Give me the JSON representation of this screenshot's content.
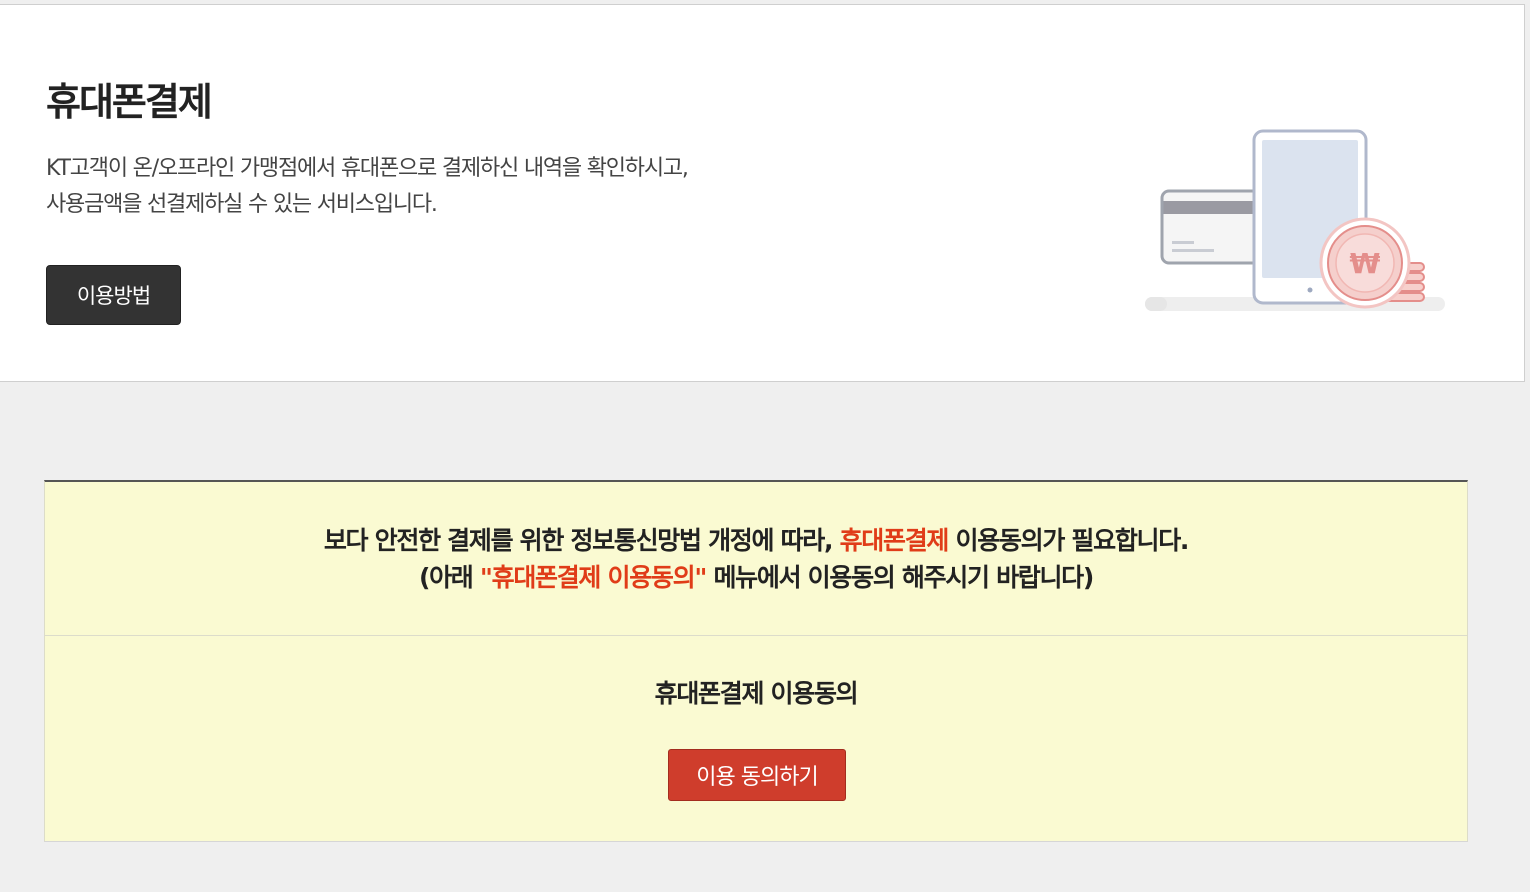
{
  "hero": {
    "title": "휴대폰결제",
    "desc_line1": "KT고객이 온/오프라인 가맹점에서 휴대폰으로 결제하신 내역을 확인하시고,",
    "desc_line2": "사용금액을 선결제하실 수 있는 서비스입니다.",
    "howto_button": "이용방법",
    "illustration": {
      "name": "card-phone-won-coin-icon",
      "won_symbol": "₩",
      "colors": {
        "outline": "#b0b8cc",
        "fill": "#dbe3ef",
        "coin": "#f3c5c3",
        "coin_outline": "#e48e8b",
        "card_stripe": "#9a9aa2",
        "shadow": "#eeeeee"
      }
    }
  },
  "notice": {
    "line1_before": "보다 안전한 결제를 위한 정보통신망법 개정에 따라, ",
    "line1_highlight": "휴대폰결제",
    "line1_after": " 이용동의가 필요합니다.",
    "line2_before": "(아래 ",
    "line2_highlight": "\"휴대폰결제 이용동의\"",
    "line2_after": " 메뉴에서 이용동의 해주시기 바랍니다)",
    "highlight_color": "#e03c18"
  },
  "agree": {
    "title": "휴대폰결제 이용동의",
    "button": "이용 동의하기",
    "button_color": "#cf3d2c"
  }
}
